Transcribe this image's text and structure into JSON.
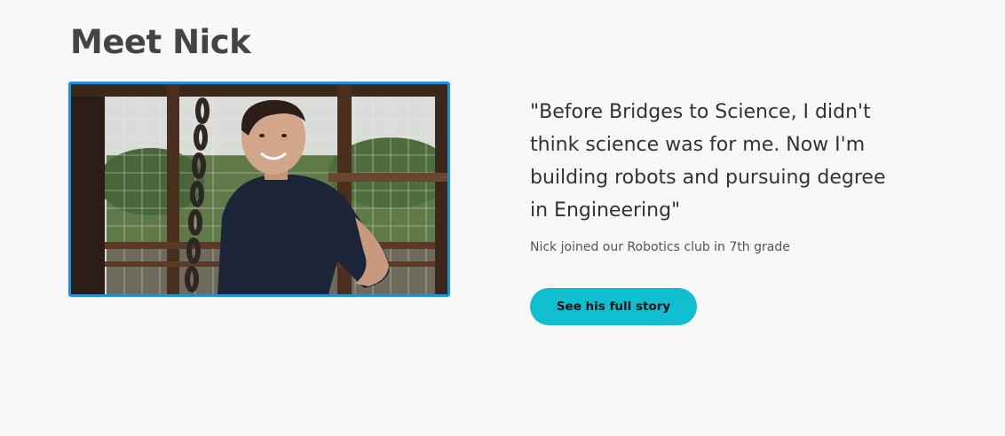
{
  "section": {
    "title": "Meet Nick"
  },
  "photo": {
    "subject": "smiling teenage boy in dark t-shirt on a wooden porch with wire fencing"
  },
  "testimonial": {
    "quote": "\"Before Bridges to Science, I didn't think science was for me. Now I'm building robots and pursuing degree in Engineering\"",
    "caption": "Nick joined our Robotics club in 7th grade"
  },
  "cta": {
    "label": "See his full story"
  },
  "colors": {
    "background": "#f8f8f8",
    "photo_border": "#1a8fe6",
    "button": "#0fbfcf",
    "heading": "#444444"
  }
}
